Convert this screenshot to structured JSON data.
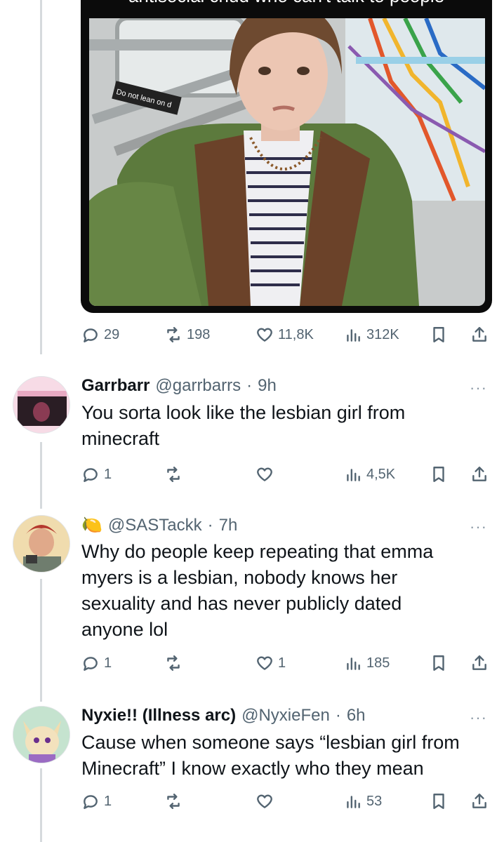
{
  "media": {
    "caption": "antisocial chud who can't talk to people",
    "sign_text": "Do not lean on d"
  },
  "main_actions": {
    "replies": "29",
    "reposts": "198",
    "likes": "11,8K",
    "views": "312K"
  },
  "replies": [
    {
      "name": "Garrbarr",
      "handle": "@garrbarrs",
      "time": "9h",
      "text_lines": [
        "You sorta look like the lesbian girl from",
        "minecraft"
      ],
      "replies": "1",
      "reposts": "",
      "likes": "",
      "views": "4,5K"
    },
    {
      "name": "🍋",
      "handle": "@SASTackk",
      "time": "7h",
      "text_lines": [
        "Why do people keep repeating that emma",
        "myers is a lesbian, nobody knows her",
        "sexuality and has never publicly dated",
        "anyone lol"
      ],
      "replies": "1",
      "reposts": "",
      "likes": "1",
      "views": "185"
    },
    {
      "name": "Nyxie!! (Illness arc)",
      "handle": "@NyxieFen",
      "time": "6h",
      "text_lines": [
        "Cause when someone says “lesbian girl from",
        "Minecraft” I know exactly who they mean"
      ],
      "replies": "1",
      "reposts": "",
      "likes": "",
      "views": "53"
    }
  ],
  "ui": {
    "dot_sep": "·",
    "more": "···"
  }
}
